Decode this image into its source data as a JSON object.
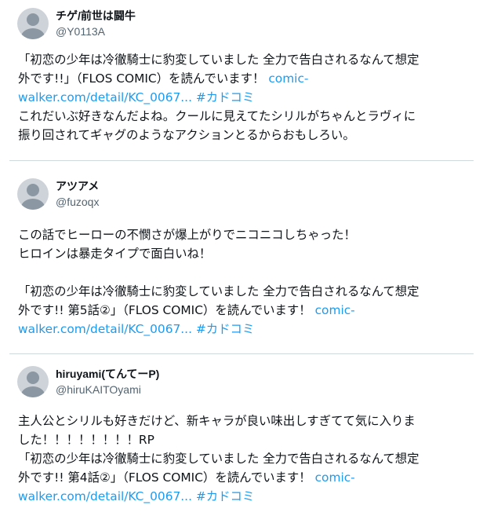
{
  "tweets": [
    {
      "display_name": "チゲ/前世は闘牛",
      "handle": "@Y0113A",
      "lines": [
        [
          {
            "text": "「初恋の少年は冷徹騎士に豹変していました 全力で告白されるなんて想定",
            "link": false
          }
        ],
        [
          {
            "text": "外です!!」（FLOS COMIC）を読んでいます！ ",
            "link": false
          },
          {
            "text": "comic-",
            "link": true
          }
        ],
        [
          {
            "text": "walker.com/detail/KC_0067...",
            "link": true
          },
          {
            "text": " ",
            "link": false
          },
          {
            "text": "#カドコミ",
            "link": true
          }
        ],
        [
          {
            "text": "これだいぶ好きなんだよね。クールに見えてたシリルがちゃんとラヴィに",
            "link": false
          }
        ],
        [
          {
            "text": "振り回されてギャグのようなアクションとるからおもしろい。",
            "link": false
          }
        ]
      ]
    },
    {
      "display_name": "アツアメ",
      "handle": "@fuzoqx",
      "lines": [
        [
          {
            "text": "この話でヒーローの不憫さが爆上がりでニコニコしちゃった！",
            "link": false
          }
        ],
        [
          {
            "text": "ヒロインは暴走タイプで面白いね！",
            "link": false
          }
        ],
        [],
        [
          {
            "text": "「初恋の少年は冷徹騎士に豹変していました 全力で告白されるなんて想定",
            "link": false
          }
        ],
        [
          {
            "text": "外です!! 第5話②」（FLOS COMIC）を読んでいます！ ",
            "link": false
          },
          {
            "text": "comic-",
            "link": true
          }
        ],
        [
          {
            "text": "walker.com/detail/KC_0067...",
            "link": true
          },
          {
            "text": " ",
            "link": false
          },
          {
            "text": "#カドコミ",
            "link": true
          }
        ]
      ]
    },
    {
      "display_name": "hiruyami(てんてーP)",
      "handle": "@hiruKAITOyami",
      "lines": [
        [
          {
            "text": "主人公とシリルも好きだけど、新キャラが良い味出しすぎてて気に入りま",
            "link": false
          }
        ],
        [
          {
            "text": "した！！！！！！！！RP",
            "link": false
          }
        ],
        [
          {
            "text": "「初恋の少年は冷徹騎士に豹変していました 全力で告白されるなんて想定",
            "link": false
          }
        ],
        [
          {
            "text": "外です!! 第4話②」（FLOS COMIC）を読んでいます！ ",
            "link": false
          },
          {
            "text": "comic-",
            "link": true
          }
        ],
        [
          {
            "text": "walker.com/detail/KC_0067...",
            "link": true
          },
          {
            "text": " ",
            "link": false
          },
          {
            "text": "#カドコミ",
            "link": true
          }
        ]
      ]
    }
  ],
  "colors": {
    "text": "#0f1419",
    "handle": "#536471",
    "link": "#1d9bf0",
    "divider": "#cfd9de",
    "avatar_bg": "#cdd3d9",
    "avatar_fg": "#8b97a2"
  },
  "icons": {
    "avatar": "default-profile-avatar-icon"
  }
}
